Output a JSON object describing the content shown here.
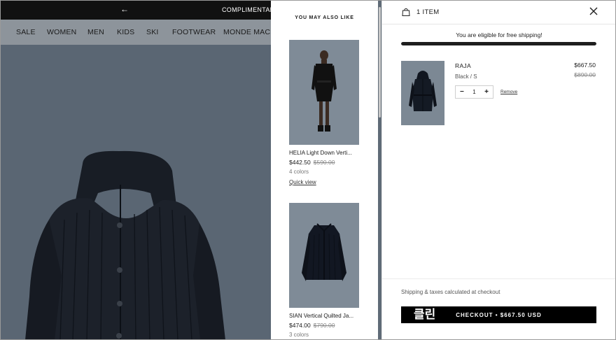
{
  "topbar": {
    "back_arrow": "←",
    "promo": "COMPLIMENTARY"
  },
  "nav": {
    "items": [
      "SALE",
      "WOMEN",
      "MEN",
      "KIDS",
      "SKI",
      "FOOTWEAR",
      "MONDE MACKA"
    ]
  },
  "recommendations": {
    "title": "YOU MAY ALSO LIKE",
    "products": [
      {
        "name": "HELIA Light Down Verti...",
        "price": "$442.50",
        "old_price": "$590.00",
        "colors": "4 colors",
        "quick_view": "Quick view"
      },
      {
        "name": "SIAN Vertical Quilted Ja...",
        "price": "$474.00",
        "old_price": "$790.00",
        "colors": "3 colors"
      }
    ]
  },
  "cart": {
    "count_label": "1 ITEM",
    "shipping_message": "You are eligible for free shipping!",
    "shipping_progress": 1.0,
    "item": {
      "name": "RAJA",
      "variant": "Black / S",
      "price": "$667.50",
      "old_price": "$890.00",
      "quantity": "1",
      "minus": "−",
      "plus": "+",
      "remove_label": "Remove"
    },
    "tax_note": "Shipping & taxes calculated at checkout",
    "checkout_badge": "클린",
    "checkout_label": "CHECKOUT  •  $667.50 USD"
  },
  "colors": {
    "accent": "#000000",
    "hero_bg": "#5a6673",
    "nav_bg": "#8d949b"
  },
  "icons": [
    "back-arrow-icon",
    "bag-icon",
    "close-icon",
    "minus-icon",
    "plus-icon"
  ]
}
